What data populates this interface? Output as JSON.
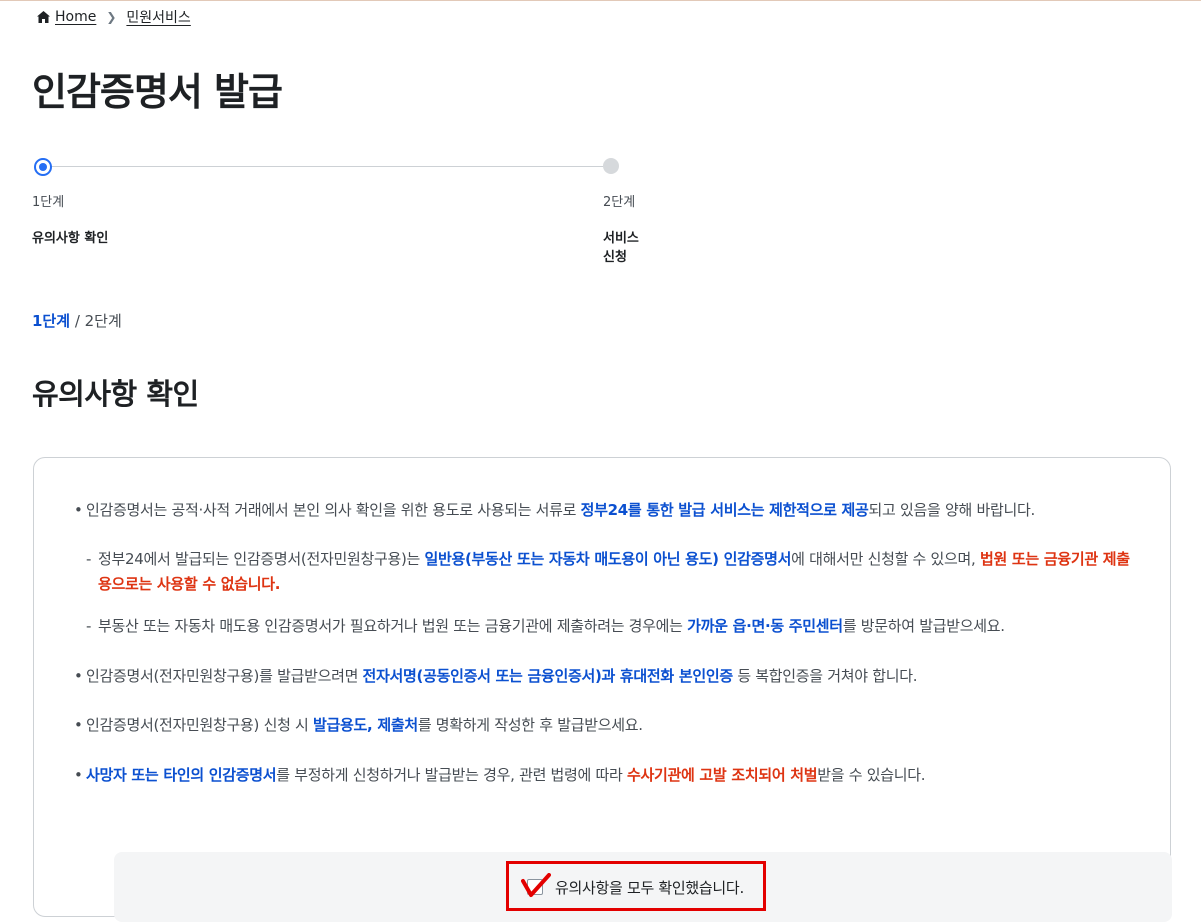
{
  "breadcrumb": {
    "home": "Home",
    "current": "민원서비스"
  },
  "page_title": "인감증명서 발급",
  "stepper": [
    {
      "num": "1단계",
      "name": "유의사항 확인",
      "active": true
    },
    {
      "num": "2단계",
      "name": "서비스 신청",
      "active": false
    }
  ],
  "step_indicator": {
    "current": "1단계",
    "separator": " / ",
    "total": "2단계"
  },
  "section_title": "유의사항 확인",
  "notices": {
    "n1": {
      "a": "인감증명서는 공적·사적 거래에서 본인 의사 확인을 위한 용도로 사용되는 서류로 ",
      "b": "정부24를 통한 발급 서비스는 제한적으로 제공",
      "c": "되고 있음을 양해 바랍니다."
    },
    "n1s1": {
      "a": "정부24에서 발급되는 인감증명서(전자민원창구용)는 ",
      "b": "일반용(부동산 또는 자동차 매도용이 아닌 용도) 인감증명서",
      "c": "에 대해서만 신청할 수 있으며, ",
      "d": "법원 또는 금융기관 제출용으로는 사용할 수 없습니다."
    },
    "n1s2": {
      "a": "부동산 또는 자동차 매도용 인감증명서가 필요하거나 법원 또는 금융기관에 제출하려는 경우에는 ",
      "b": "가까운 읍·면·동 주민센터",
      "c": "를 방문하여 발급받으세요."
    },
    "n2": {
      "a": "인감증명서(전자민원창구용)를 발급받으려면 ",
      "b": "전자서명(공동인증서 또는 금융인증서)과 휴대전화 본인인증",
      "c": " 등 복합인증을 거쳐야 합니다."
    },
    "n3": {
      "a": "인감증명서(전자민원창구용) 신청 시 ",
      "b": "발급용도, 제출처",
      "c": "를 명확하게 작성한 후 발급받으세요."
    },
    "n4": {
      "a": "사망자 또는 타인의 인감증명서",
      "b": "를 부정하게 신청하거나 발급받는 경우, 관련 법령에 따라 ",
      "c": "수사기관에 고발 조치되어 처벌",
      "d": "받을 수 있습니다."
    }
  },
  "confirm": {
    "label": "유의사항을 모두 확인했습니다.",
    "checked": true
  },
  "colors": {
    "primary_blue": "#0b50d0",
    "warning_red": "#de3412",
    "highlight": "#e30000",
    "step_active": "#256ef4"
  }
}
